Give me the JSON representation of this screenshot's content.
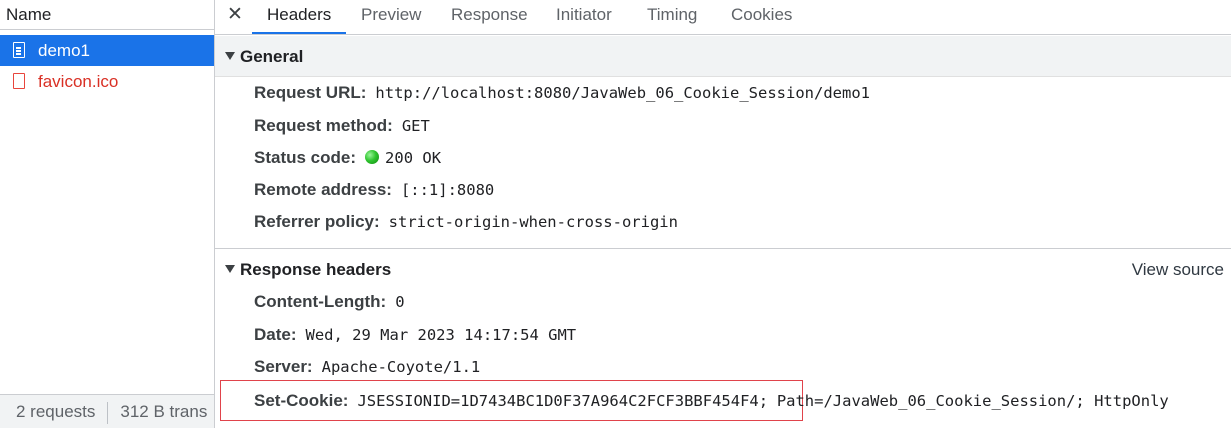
{
  "left_panel": {
    "header": "Name",
    "requests": [
      {
        "name": "demo1",
        "selected": true,
        "icon": "document-icon"
      },
      {
        "name": "favicon.ico",
        "selected": false,
        "icon": "file-error-icon",
        "color": "#d93025"
      }
    ],
    "status": {
      "count": "2 requests",
      "transferred": "312 B trans"
    }
  },
  "tabs": {
    "close": "✕",
    "items": [
      "Headers",
      "Preview",
      "Response",
      "Initiator",
      "Timing",
      "Cookies"
    ],
    "active": "Headers"
  },
  "general": {
    "title": "General",
    "rows": [
      {
        "key": "Request URL:",
        "value": "http://localhost:8080/JavaWeb_06_Cookie_Session/demo1"
      },
      {
        "key": "Request method:",
        "value": "GET"
      },
      {
        "key": "Status code:",
        "value": "200 OK",
        "status_color": "#30c530"
      },
      {
        "key": "Remote address:",
        "value": "[::1]:8080"
      },
      {
        "key": "Referrer policy:",
        "value": "strict-origin-when-cross-origin"
      }
    ]
  },
  "response_headers": {
    "title": "Response headers",
    "view_source": "View source",
    "rows": [
      {
        "key": "Content-Length:",
        "value": "0"
      },
      {
        "key": "Date:",
        "value": "Wed, 29 Mar 2023 14:17:54 GMT"
      },
      {
        "key": "Server:",
        "value": "Apache-Coyote/1.1"
      },
      {
        "key": "Set-Cookie:",
        "value": "JSESSIONID=1D7434BC1D0F37A964C2FCF3BBF454F4;",
        "value_rest": "Path=/JavaWeb_06_Cookie_Session/; HttpOnly"
      }
    ]
  },
  "colors": {
    "accent": "#1a73e8",
    "highlight_border": "#e0434b"
  }
}
